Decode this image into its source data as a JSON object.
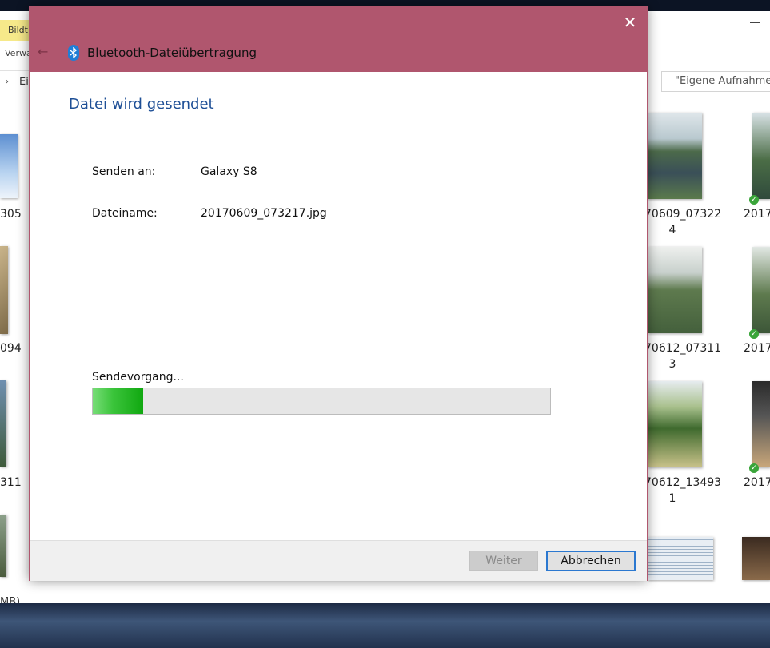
{
  "explorer": {
    "ribbon_tab": "Bildt",
    "ribbon_sub": "Verwa",
    "address_fragment": "Ei",
    "search_placeholder": "\"Eigene Aufnahmen\"",
    "status_fragment": "MB)",
    "captions_left": [
      "305",
      "094",
      "311"
    ],
    "captions_right": [
      {
        "line1": "70609_07322",
        "line2": "4",
        "far": "2017"
      },
      {
        "line1": "70612_07311",
        "line2": "3",
        "far": "2017"
      },
      {
        "line1": "70612_13493",
        "line2": "1",
        "far": "2017"
      }
    ]
  },
  "dialog": {
    "title": "Bluetooth-Dateiübertragung",
    "heading": "Datei wird gesendet",
    "send_to_label": "Senden an:",
    "send_to_value": "Galaxy S8",
    "filename_label": "Dateiname:",
    "filename_value": "20170609_073217.jpg",
    "progress_label": "Sendevorgang...",
    "progress_fraction": 0.11,
    "next_button": "Weiter",
    "cancel_button": "Abbrechen"
  },
  "icons": [
    "close-icon",
    "bluetooth-icon",
    "back-arrow-icon",
    "search-icon",
    "sync-check-icon"
  ],
  "colors": {
    "titlebar": "#b0566e",
    "heading": "#1e4f96",
    "progress": "#10a810",
    "focus_border": "#2b78d0"
  }
}
